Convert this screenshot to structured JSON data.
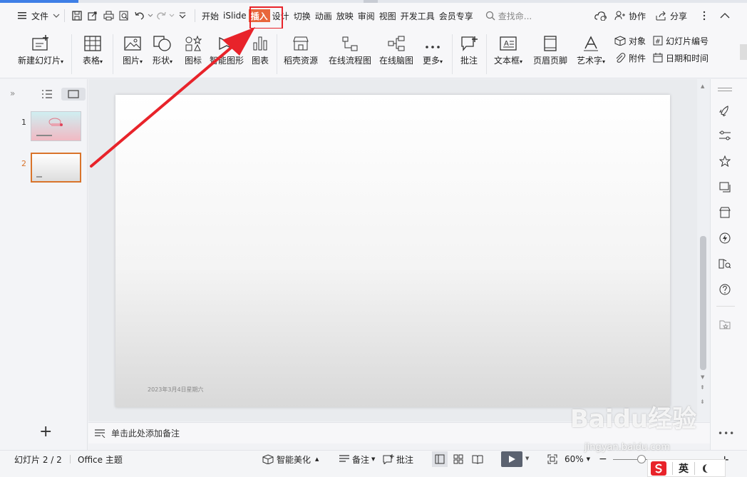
{
  "menu": {
    "file_label": "文件",
    "tabs": [
      {
        "label": "开始"
      },
      {
        "label": "iSlide"
      },
      {
        "label": "插入"
      },
      {
        "label": "设计"
      },
      {
        "label": "切换"
      },
      {
        "label": "动画"
      },
      {
        "label": "放映"
      },
      {
        "label": "审阅"
      },
      {
        "label": "视图"
      },
      {
        "label": "开发工具"
      },
      {
        "label": "会员专享"
      }
    ],
    "active_tab": "插入",
    "search_placeholder": "查找命...",
    "collab_label": "协作",
    "share_label": "分享"
  },
  "ribbon": {
    "new_slide": "新建幻灯片",
    "table": "表格",
    "picture": "图片",
    "shape": "形状",
    "icon": "图标",
    "smartart": "智能图形",
    "chart": "图表",
    "daoke": "稻壳资源",
    "flowchart": "在线流程图",
    "mindmap": "在线脑图",
    "more": "更多",
    "comment": "批注",
    "textbox": "文本框",
    "header_footer": "页眉页脚",
    "wordart": "艺术字",
    "object": "对象",
    "slide_number": "幻灯片编号",
    "attachment": "附件",
    "datetime": "日期和时间"
  },
  "slides": [
    {
      "number": "1"
    },
    {
      "number": "2"
    }
  ],
  "slide": {
    "date_text": "2023年3月4日星期六"
  },
  "notes_placeholder": "单击此处添加备注",
  "status": {
    "slide_count": "幻灯片 2 / 2",
    "theme": "Office 主题",
    "beautify": "智能美化",
    "notes": "备注",
    "comments": "批注",
    "zoom": "60%"
  },
  "watermark": {
    "brand": "Baidu经验",
    "url": "jingyan.baidu.com"
  },
  "tray": {
    "ime_lang": "英"
  },
  "colors": {
    "accent": "#e8673c",
    "highlight_box": "#e8232a",
    "arrow": "#e8232a",
    "selected_thumb": "#d9742b"
  }
}
